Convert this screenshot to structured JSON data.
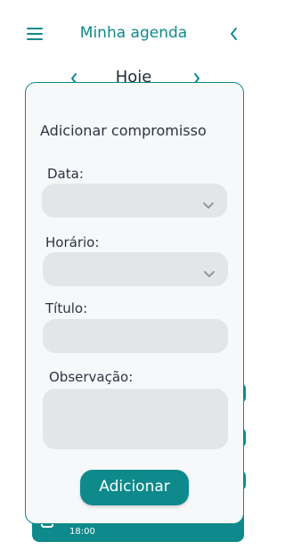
{
  "header": {
    "title": "Minha agenda",
    "menu_icon": "hamburger-icon",
    "back_icon": "chevron-left-icon"
  },
  "date_nav": {
    "label": "Hoje",
    "prev_icon": "chevron-left-icon",
    "next_icon": "chevron-right-icon"
  },
  "background_list": {
    "visible_time": "18:00"
  },
  "modal": {
    "title": "Adicionar compromisso",
    "fields": {
      "date": {
        "label": "Data:",
        "value": ""
      },
      "time": {
        "label": "Horário:",
        "value": ""
      },
      "title": {
        "label": "Título:",
        "value": ""
      },
      "notes": {
        "label": "Observação:",
        "value": ""
      }
    },
    "submit_label": "Adicionar"
  },
  "colors": {
    "accent": "#0f8a8c",
    "field_bg": "#e3e5e8",
    "modal_bg": "#f6f8fa"
  }
}
